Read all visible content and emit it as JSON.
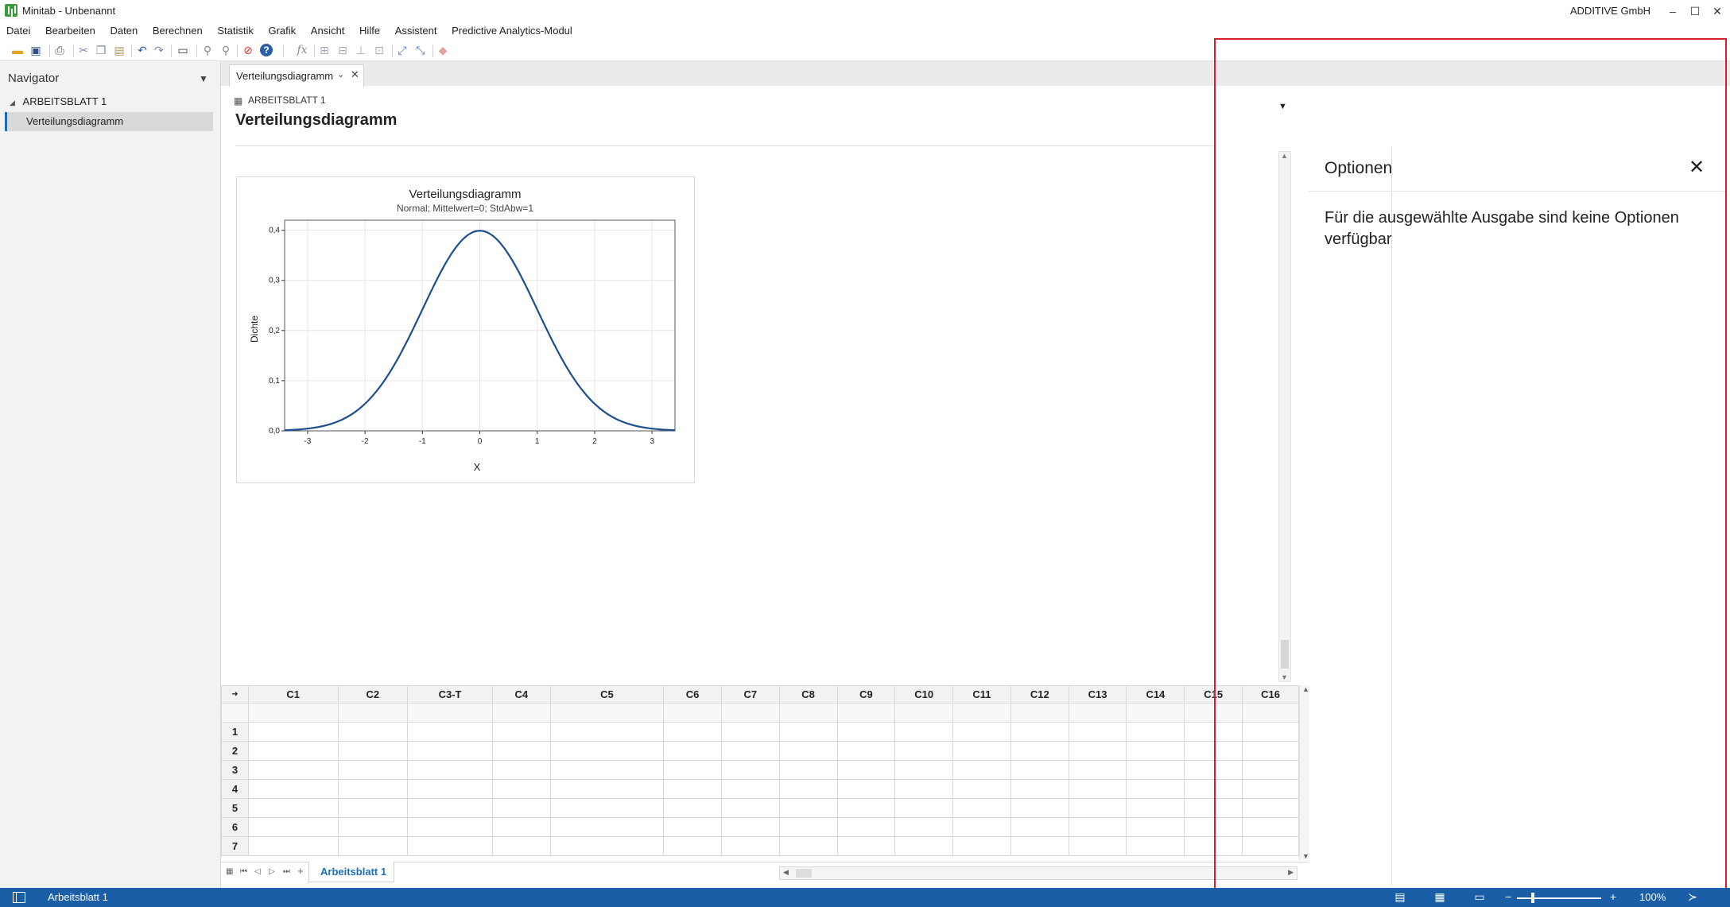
{
  "window": {
    "title": "Minitab - Unbenannt",
    "company": "ADDITIVE GmbH",
    "minimize": "–",
    "maximize": "☐",
    "close": "✕"
  },
  "menu": [
    "Datei",
    "Bearbeiten",
    "Daten",
    "Berechnen",
    "Statistik",
    "Grafik",
    "Ansicht",
    "Hilfe",
    "Assistent",
    "Predictive Analytics-Modul"
  ],
  "navigator": {
    "title": "Navigator",
    "group": "ARBEITSBLATT 1",
    "item": "Verteilungsdiagramm"
  },
  "output": {
    "tab_label": "Verteilungsdiagramm",
    "worksheet_label": "ARBEITSBLATT 1",
    "title": "Verteilungsdiagramm"
  },
  "chart_data": {
    "type": "line",
    "title": "Verteilungsdiagramm",
    "subtitle": "Normal; Mittelwert=0; StdAbw=1",
    "xlabel": "X",
    "ylabel": "Dichte",
    "xlim": [
      -3.4,
      3.4
    ],
    "ylim": [
      0,
      0.42
    ],
    "xticks": [
      "-3",
      "-2",
      "-1",
      "0",
      "1",
      "2",
      "3"
    ],
    "yticks": [
      "0,0",
      "0,1",
      "0,2",
      "0,3",
      "0,4"
    ],
    "grid": true,
    "series": [
      {
        "distribution": "normal",
        "mean": 0,
        "sd": 1,
        "color": "#1c4f8c"
      }
    ]
  },
  "options_panel": {
    "title": "Optionen",
    "message": "Für die ausgewählte Ausgabe sind keine Optionen verfügbar",
    "close": "✕"
  },
  "worksheet": {
    "columns": [
      "C1",
      "C2",
      "C3-T",
      "C4",
      "C5",
      "C6",
      "C7",
      "C8",
      "C9",
      "C10",
      "C11",
      "C12",
      "C13",
      "C14",
      "C15",
      "C16"
    ],
    "rows": [
      "1",
      "2",
      "3",
      "4",
      "5",
      "6",
      "7"
    ],
    "sheet_tab": "Arbeitsblatt 1"
  },
  "statusbar": {
    "sheet": "Arbeitsblatt 1",
    "zoom": "100%"
  },
  "colors": {
    "accent": "#1b5ea8",
    "curve": "#1c4f8c",
    "highlight_frame": "#d81e2a"
  }
}
